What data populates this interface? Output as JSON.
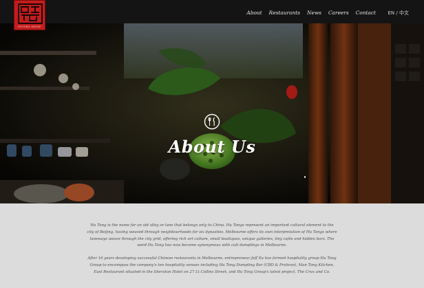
{
  "brand": {
    "logo_name": "hutong-group-logo",
    "logo_subtext": "HUTONG GROUP",
    "accent_color": "#c41c1c"
  },
  "nav": {
    "items": [
      {
        "label": "About"
      },
      {
        "label": "Restaurants"
      },
      {
        "label": "News"
      },
      {
        "label": "Careers"
      },
      {
        "label": "Contact"
      }
    ],
    "lang_en": "EN",
    "lang_sep": "/",
    "lang_cn": "中文"
  },
  "hero": {
    "icon": "fork-knife-icon",
    "title": "About Us"
  },
  "content": {
    "paragraphs": [
      "Hu Tong is the name for an old alley or lane that belongs only to China. Hu Tongs represent an important cultural element to the city of Beijing, having weaved through neighbourhoods for six dynasties. Melbourne offers its own interpretation of Hu Tongs where laneways weave through the city grid, offering rich art culture, small boutiques, unique galleries, tiny cafés and hidden bars. The word Hu Tong has now become synonymous with cult dumplings in Melbourne.",
      "After 16 years developing successful Chinese restaurants in Melbourne, entrepreneur Jeff Xu has formed hospitality group Hu Tong Group to encompass the company's ten hospitality venues including Hu Tong Dumpling Bar (CBD & Prahran), Man Tong Kitchen, East Restaurant situated in the Sheraton Hotel on 27 Lt Collins Street, and Hu Tong Group's latest project, The Crux and Co."
    ]
  }
}
